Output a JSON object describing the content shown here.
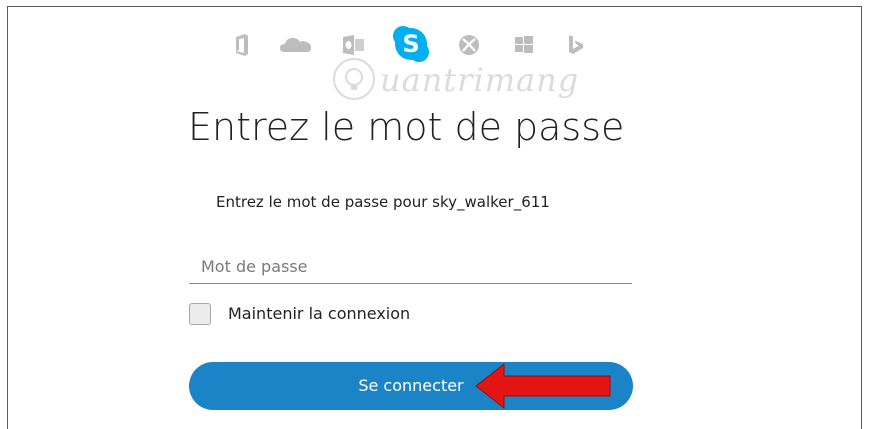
{
  "app_icons": {
    "office": "office-icon",
    "onedrive": "onedrive-icon",
    "outlook": "outlook-icon",
    "skype": "skype-icon",
    "xbox": "xbox-icon",
    "windows": "windows-icon",
    "bing": "bing-icon"
  },
  "watermark": {
    "text": "uantrimang"
  },
  "login": {
    "title": "Entrez le mot de passe",
    "subtitle": "Entrez le mot de passe pour sky_walker_611",
    "password_placeholder": "Mot de passe",
    "password_value": "",
    "remember_label": "Maintenir la connexion",
    "remember_checked": false,
    "submit_label": "Se connecter"
  },
  "colors": {
    "primary_button": "#1a84c6",
    "skype_blue": "#00aff0",
    "muted_icon": "#bdbdbd",
    "annotation_arrow": "#e31414"
  }
}
